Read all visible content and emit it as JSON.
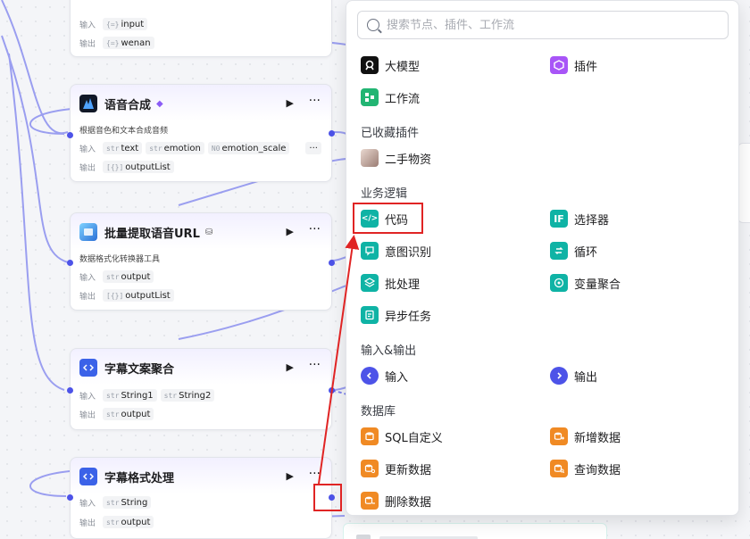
{
  "nodes": {
    "top": {
      "in_label": "输入",
      "in_chip_type": "{=}",
      "in_chip": "input",
      "out_label": "输出",
      "out_chip_type": "{=}",
      "out_chip": "wenan"
    },
    "tts": {
      "title": "语音合成",
      "badge": "◆",
      "desc": "根据音色和文本合成音频",
      "in_label": "输入",
      "out_label": "输出",
      "inputs": [
        {
          "type": "str",
          "name": "text"
        },
        {
          "type": "str",
          "name": "emotion"
        },
        {
          "type": "N0",
          "name": "emotion_scale"
        }
      ],
      "outputs": [
        {
          "type": "[{}]",
          "name": "outputList"
        }
      ]
    },
    "batch": {
      "title": "批量提取语音URL",
      "badge": "⛁",
      "desc": "数据格式化转换器工具",
      "in_label": "输入",
      "out_label": "输出",
      "inputs": [
        {
          "type": "str",
          "name": "output"
        }
      ],
      "outputs": [
        {
          "type": "[{}]",
          "name": "outputList"
        }
      ]
    },
    "subagg": {
      "title": "字幕文案聚合",
      "in_label": "输入",
      "out_label": "输出",
      "inputs": [
        {
          "type": "str",
          "name": "String1"
        },
        {
          "type": "str",
          "name": "String2"
        }
      ],
      "outputs": [
        {
          "type": "str",
          "name": "output"
        }
      ]
    },
    "subfmt": {
      "title": "字幕格式处理",
      "in_label": "输入",
      "out_label": "输出",
      "inputs": [
        {
          "type": "str",
          "name": "String"
        }
      ],
      "outputs": [
        {
          "type": "str",
          "name": "output"
        }
      ]
    }
  },
  "panel": {
    "search_placeholder": "搜索节点、插件、工作流",
    "top_items": [
      {
        "label": "大模型",
        "icon": "llm-icon"
      },
      {
        "label": "插件",
        "icon": "plugin-icon"
      },
      {
        "label": "工作流",
        "icon": "workflow-icon"
      }
    ],
    "sections": {
      "favorites": "已收藏插件",
      "logic": "业务逻辑",
      "io": "输入&输出",
      "db": "数据库"
    },
    "favorites": [
      {
        "label": "二手物资",
        "icon": "avatar-icon"
      }
    ],
    "logic": [
      {
        "label": "代码",
        "icon": "code-icon"
      },
      {
        "label": "选择器",
        "icon": "selector-icon"
      },
      {
        "label": "意图识别",
        "icon": "intent-icon"
      },
      {
        "label": "循环",
        "icon": "loop-icon"
      },
      {
        "label": "批处理",
        "icon": "batch-icon"
      },
      {
        "label": "变量聚合",
        "icon": "variable-merge-icon"
      },
      {
        "label": "异步任务",
        "icon": "async-task-icon"
      }
    ],
    "io": [
      {
        "label": "输入",
        "icon": "input-icon"
      },
      {
        "label": "输出",
        "icon": "output-icon"
      }
    ],
    "db": [
      {
        "label": "SQL自定义",
        "icon": "sql-icon"
      },
      {
        "label": "新增数据",
        "icon": "add-data-icon"
      },
      {
        "label": "更新数据",
        "icon": "update-data-icon"
      },
      {
        "label": "查询数据",
        "icon": "query-data-icon"
      },
      {
        "label": "删除数据",
        "icon": "delete-data-icon"
      }
    ]
  },
  "colors": {
    "accent": "#4d53e8",
    "teal": "#0fb3a5",
    "orange": "#f08a24",
    "purple": "#a855f7",
    "green": "#22b573",
    "blue": "#3b62e8",
    "annotation_red": "#e02424"
  }
}
